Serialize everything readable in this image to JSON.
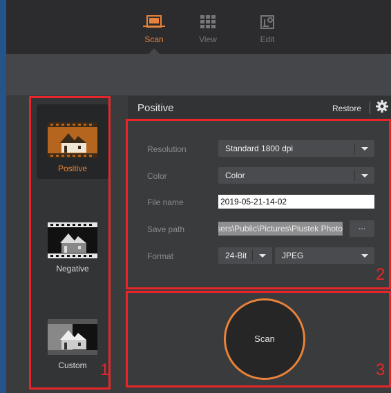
{
  "nav": {
    "tabs": [
      {
        "label": "Scan",
        "icon": "scan-icon",
        "active": true
      },
      {
        "label": "View",
        "icon": "grid-view-icon",
        "active": false
      },
      {
        "label": "Edit",
        "icon": "edit-tools-icon",
        "active": false
      }
    ]
  },
  "modes": [
    {
      "label": "Positive",
      "icon": "positive-film-icon",
      "active": true
    },
    {
      "label": "Negative",
      "icon": "negative-film-icon",
      "active": false
    },
    {
      "label": "Custom",
      "icon": "custom-film-icon",
      "active": false
    }
  ],
  "panel": {
    "title": "Positive",
    "restore_label": "Restore",
    "settings": {
      "resolution": {
        "label": "Resolution",
        "value": "Standard 1800 dpi"
      },
      "color": {
        "label": "Color",
        "value": "Color"
      },
      "file_name": {
        "label": "File name",
        "value": "2019-05-21-14-02"
      },
      "save_path": {
        "label": "Save path",
        "value": "C:\\Users\\Public\\Pictures\\Plustek Photo",
        "browse_label": "..."
      },
      "format": {
        "label": "Format",
        "bit_depth": "24-Bit",
        "type": "JPEG"
      }
    }
  },
  "scan_button_label": "Scan",
  "annotations": [
    "1",
    "2",
    "3"
  ],
  "colors": {
    "accent": "#e8823a",
    "annotation": "#e8262a",
    "side_stripe": "#23558a"
  }
}
